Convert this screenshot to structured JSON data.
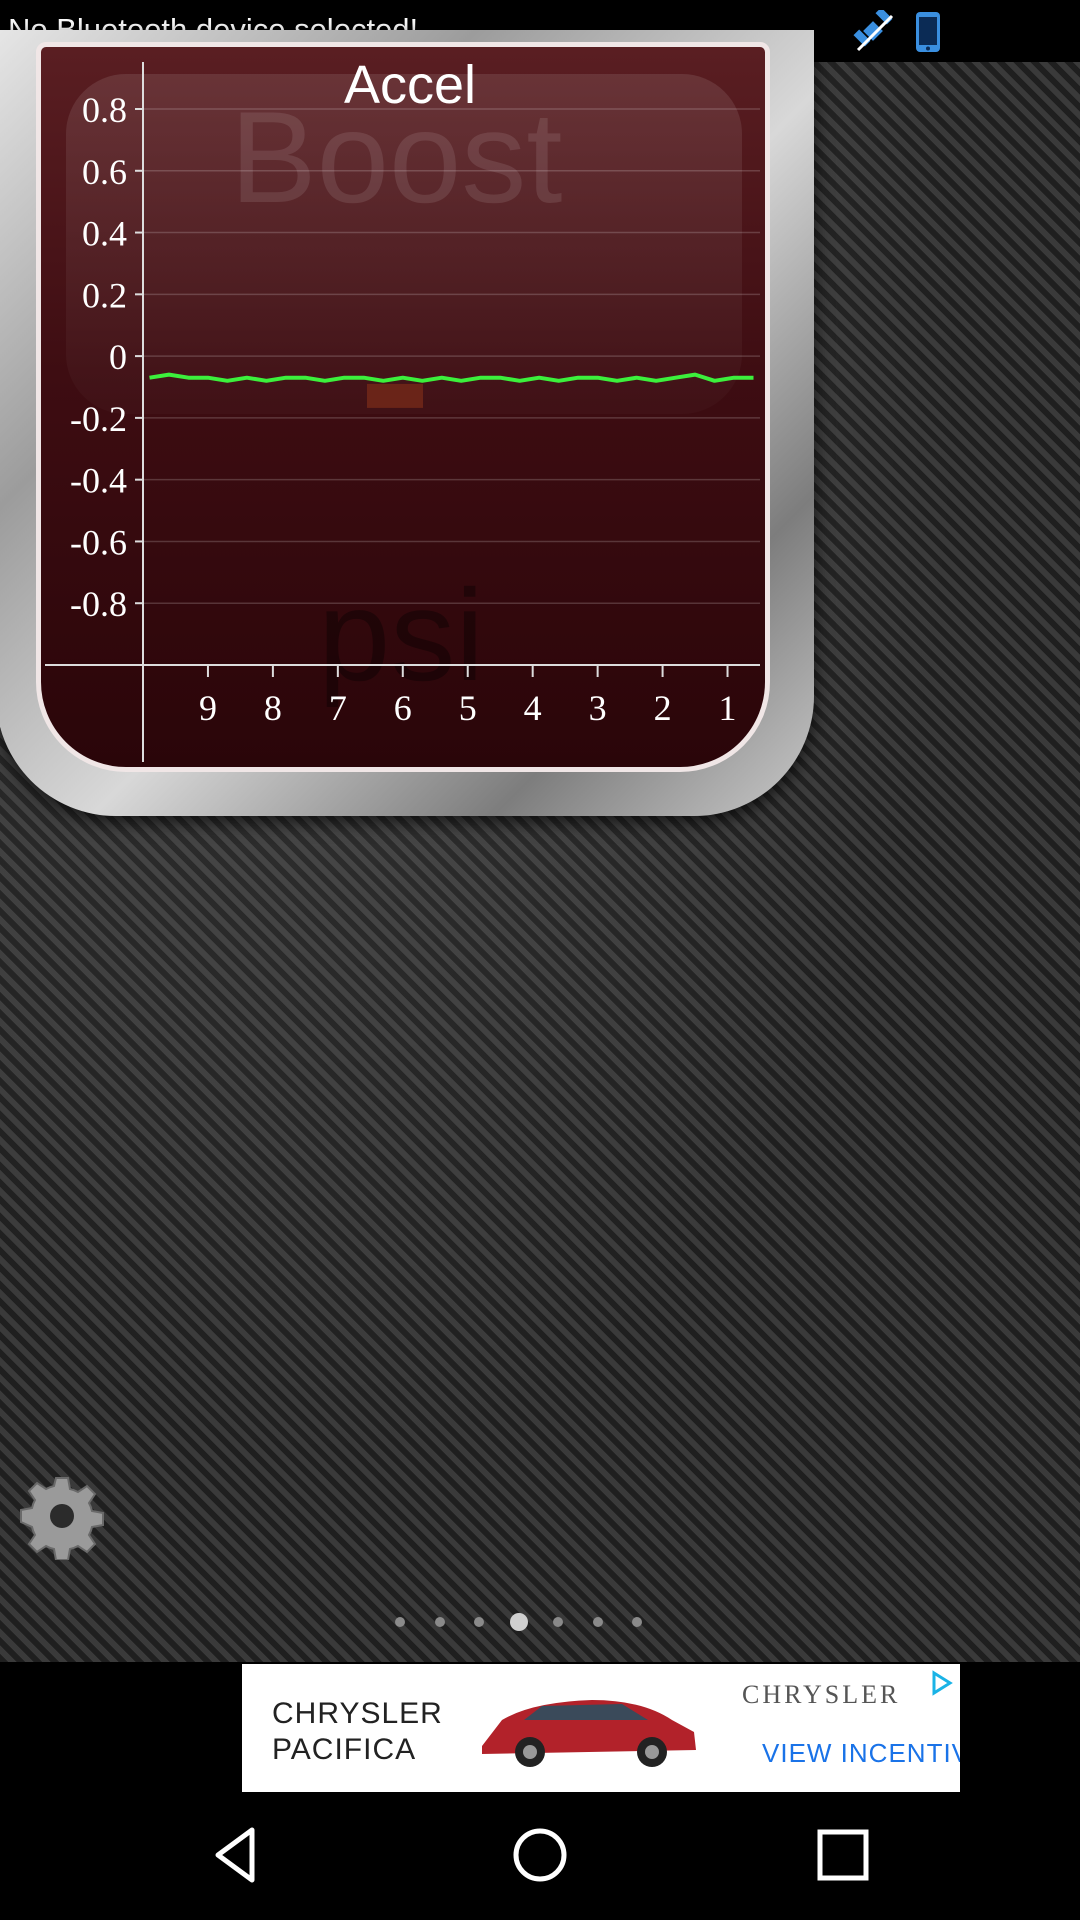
{
  "status_bar": {
    "message": "No Bluetooth device selected!",
    "icons": [
      "satellite-icon",
      "phone-icon"
    ],
    "icon_color": "#3a8fe0"
  },
  "gauge": {
    "watermark_top": "Boost",
    "watermark_bottom": "psi",
    "accent_line_color": "#3cf03c"
  },
  "chart_data": {
    "type": "line",
    "title": "Accel",
    "xlabel": "",
    "ylabel": "",
    "ylim": [
      -1.0,
      0.8
    ],
    "y_ticks": [
      "0.8",
      "0.6",
      "0.4",
      "0.2",
      "0",
      "-0.2",
      "-0.4",
      "-0.6",
      "-0.8"
    ],
    "x_ticks": [
      "9",
      "8",
      "7",
      "6",
      "5",
      "4",
      "3",
      "2",
      "1"
    ],
    "x_range": [
      10,
      0.5
    ],
    "grid": true,
    "series": [
      {
        "color": "#3cf03c",
        "x": [
          9.9,
          9.6,
          9.3,
          9.0,
          8.7,
          8.4,
          8.1,
          7.8,
          7.5,
          7.2,
          6.9,
          6.6,
          6.3,
          6.0,
          5.7,
          5.4,
          5.1,
          4.8,
          4.5,
          4.2,
          3.9,
          3.6,
          3.3,
          3.0,
          2.7,
          2.4,
          2.1,
          1.8,
          1.5,
          1.2,
          0.9,
          0.6
        ],
        "values": [
          -0.07,
          -0.06,
          -0.07,
          -0.07,
          -0.08,
          -0.07,
          -0.08,
          -0.07,
          -0.07,
          -0.08,
          -0.07,
          -0.07,
          -0.08,
          -0.07,
          -0.08,
          -0.07,
          -0.08,
          -0.07,
          -0.07,
          -0.08,
          -0.07,
          -0.08,
          -0.07,
          -0.07,
          -0.08,
          -0.07,
          -0.08,
          -0.07,
          -0.06,
          -0.08,
          -0.07,
          -0.07
        ]
      }
    ]
  },
  "settings": {
    "icon": "gear-icon"
  },
  "pager": {
    "count": 7,
    "active_index": 3
  },
  "ad": {
    "brand_line1": "CHRYSLER",
    "brand_line2": "PACIFICA",
    "logo_text": "CHRYSLER",
    "cta": "VIEW INCENTIVES"
  },
  "navbar": {
    "icons": [
      "back-icon",
      "home-icon",
      "recents-icon"
    ]
  }
}
